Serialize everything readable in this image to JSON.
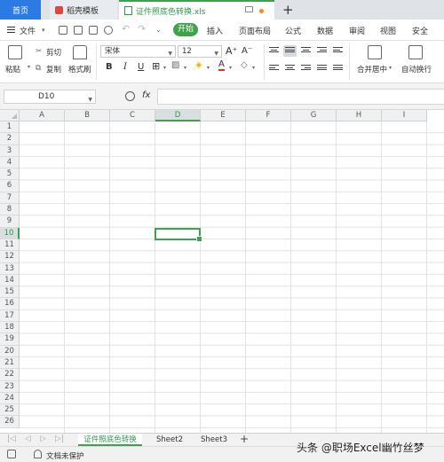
{
  "titlebar": {
    "home_tab": "首页",
    "template_tab": "稻壳模板",
    "file_tab": "证件照底色转换.xls",
    "new_tab": "+"
  },
  "menubar": {
    "file_label": "文件",
    "start_label": "开始",
    "items": [
      "插入",
      "页面布局",
      "公式",
      "数据",
      "审阅",
      "视图",
      "安全"
    ]
  },
  "ribbon": {
    "paste": "粘贴",
    "cut": "剪切",
    "copy": "复制",
    "format_painter": "格式刷",
    "font_name": "宋体",
    "font_size": "12",
    "bold": "B",
    "italic": "I",
    "underline": "U",
    "merge_center": "合并居中",
    "wrap_text": "自动换行",
    "grow_font": "A⁺",
    "shrink_font": "A⁻"
  },
  "formulabar": {
    "cell_ref": "D10",
    "fx": "fx"
  },
  "grid": {
    "columns": [
      "A",
      "B",
      "C",
      "D",
      "E",
      "F",
      "G",
      "H",
      "I"
    ],
    "rows": [
      "1",
      "2",
      "3",
      "4",
      "5",
      "6",
      "7",
      "8",
      "9",
      "10",
      "11",
      "12",
      "13",
      "14",
      "15",
      "16",
      "17",
      "18",
      "19",
      "20",
      "21",
      "22",
      "23",
      "24",
      "25",
      "26"
    ],
    "active_column": "D",
    "active_row": "10"
  },
  "sheets": {
    "tabs": [
      "证件照底色转换",
      "Sheet2",
      "Sheet3"
    ],
    "active": "证件照底色转换",
    "add": "+"
  },
  "status": {
    "protect_text": "文档未保护"
  },
  "watermark": "头条 @职场Excel幽竹丝梦",
  "colors": {
    "accent_green": "#3fa24a",
    "home_blue": "#2c7be5"
  }
}
